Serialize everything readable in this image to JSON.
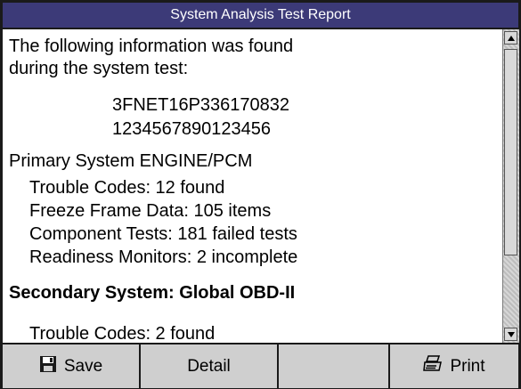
{
  "window": {
    "title": "System Analysis Test Report"
  },
  "report": {
    "intro_line1": "The following information was found",
    "intro_line2": "during the system test:",
    "vin": "3FNET16P336170832",
    "id_number": "1234567890123456",
    "primary": {
      "heading": "Primary System ENGINE/PCM",
      "trouble_codes": "Trouble Codes:  12 found",
      "freeze_frame": "Freeze Frame Data:  105 items",
      "component_tests": "Component Tests:  181 failed tests",
      "readiness": "Readiness Monitors:  2 incomplete"
    },
    "secondary": {
      "heading": "Secondary System: Global OBD-II",
      "trouble_codes": "Trouble Codes:  2 found"
    }
  },
  "toolbar": {
    "save_label": "Save",
    "detail_label": "Detail",
    "blank_label": "",
    "print_label": "Print"
  },
  "icons": {
    "save": "floppy-disk-icon",
    "print": "printer-icon",
    "scroll_up": "arrow-up-icon",
    "scroll_down": "arrow-down-icon"
  },
  "colors": {
    "title_bar": "#3c3a78",
    "toolbar": "#c9c9c9"
  }
}
